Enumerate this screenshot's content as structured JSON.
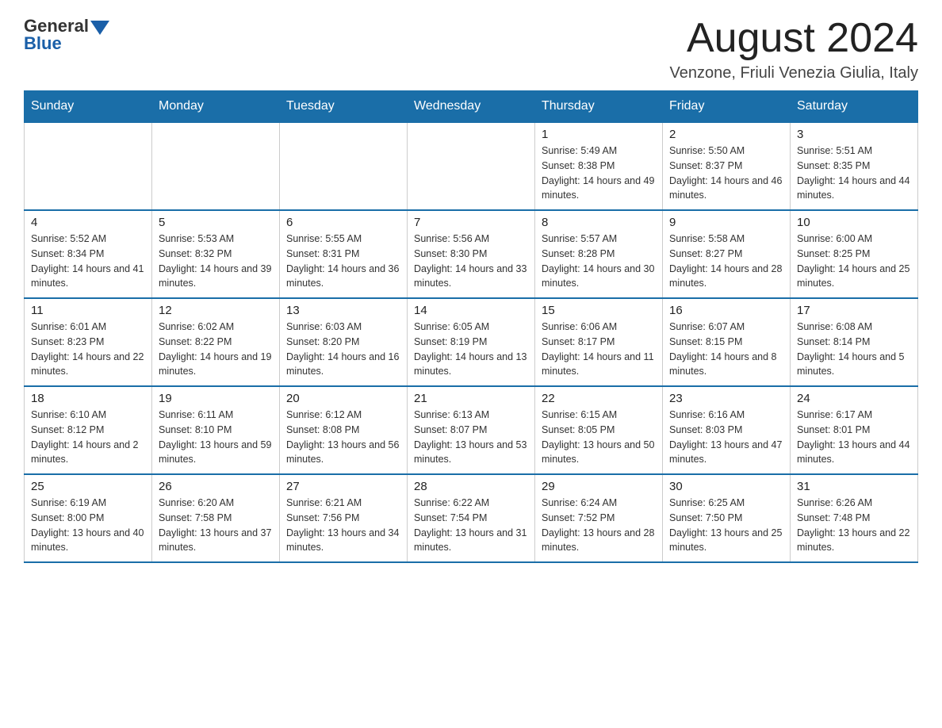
{
  "logo": {
    "text_general": "General",
    "text_blue": "Blue"
  },
  "header": {
    "month_title": "August 2024",
    "location": "Venzone, Friuli Venezia Giulia, Italy"
  },
  "weekdays": [
    "Sunday",
    "Monday",
    "Tuesday",
    "Wednesday",
    "Thursday",
    "Friday",
    "Saturday"
  ],
  "weeks": [
    [
      {
        "day": "",
        "info": ""
      },
      {
        "day": "",
        "info": ""
      },
      {
        "day": "",
        "info": ""
      },
      {
        "day": "",
        "info": ""
      },
      {
        "day": "1",
        "info": "Sunrise: 5:49 AM\nSunset: 8:38 PM\nDaylight: 14 hours and 49 minutes."
      },
      {
        "day": "2",
        "info": "Sunrise: 5:50 AM\nSunset: 8:37 PM\nDaylight: 14 hours and 46 minutes."
      },
      {
        "day": "3",
        "info": "Sunrise: 5:51 AM\nSunset: 8:35 PM\nDaylight: 14 hours and 44 minutes."
      }
    ],
    [
      {
        "day": "4",
        "info": "Sunrise: 5:52 AM\nSunset: 8:34 PM\nDaylight: 14 hours and 41 minutes."
      },
      {
        "day": "5",
        "info": "Sunrise: 5:53 AM\nSunset: 8:32 PM\nDaylight: 14 hours and 39 minutes."
      },
      {
        "day": "6",
        "info": "Sunrise: 5:55 AM\nSunset: 8:31 PM\nDaylight: 14 hours and 36 minutes."
      },
      {
        "day": "7",
        "info": "Sunrise: 5:56 AM\nSunset: 8:30 PM\nDaylight: 14 hours and 33 minutes."
      },
      {
        "day": "8",
        "info": "Sunrise: 5:57 AM\nSunset: 8:28 PM\nDaylight: 14 hours and 30 minutes."
      },
      {
        "day": "9",
        "info": "Sunrise: 5:58 AM\nSunset: 8:27 PM\nDaylight: 14 hours and 28 minutes."
      },
      {
        "day": "10",
        "info": "Sunrise: 6:00 AM\nSunset: 8:25 PM\nDaylight: 14 hours and 25 minutes."
      }
    ],
    [
      {
        "day": "11",
        "info": "Sunrise: 6:01 AM\nSunset: 8:23 PM\nDaylight: 14 hours and 22 minutes."
      },
      {
        "day": "12",
        "info": "Sunrise: 6:02 AM\nSunset: 8:22 PM\nDaylight: 14 hours and 19 minutes."
      },
      {
        "day": "13",
        "info": "Sunrise: 6:03 AM\nSunset: 8:20 PM\nDaylight: 14 hours and 16 minutes."
      },
      {
        "day": "14",
        "info": "Sunrise: 6:05 AM\nSunset: 8:19 PM\nDaylight: 14 hours and 13 minutes."
      },
      {
        "day": "15",
        "info": "Sunrise: 6:06 AM\nSunset: 8:17 PM\nDaylight: 14 hours and 11 minutes."
      },
      {
        "day": "16",
        "info": "Sunrise: 6:07 AM\nSunset: 8:15 PM\nDaylight: 14 hours and 8 minutes."
      },
      {
        "day": "17",
        "info": "Sunrise: 6:08 AM\nSunset: 8:14 PM\nDaylight: 14 hours and 5 minutes."
      }
    ],
    [
      {
        "day": "18",
        "info": "Sunrise: 6:10 AM\nSunset: 8:12 PM\nDaylight: 14 hours and 2 minutes."
      },
      {
        "day": "19",
        "info": "Sunrise: 6:11 AM\nSunset: 8:10 PM\nDaylight: 13 hours and 59 minutes."
      },
      {
        "day": "20",
        "info": "Sunrise: 6:12 AM\nSunset: 8:08 PM\nDaylight: 13 hours and 56 minutes."
      },
      {
        "day": "21",
        "info": "Sunrise: 6:13 AM\nSunset: 8:07 PM\nDaylight: 13 hours and 53 minutes."
      },
      {
        "day": "22",
        "info": "Sunrise: 6:15 AM\nSunset: 8:05 PM\nDaylight: 13 hours and 50 minutes."
      },
      {
        "day": "23",
        "info": "Sunrise: 6:16 AM\nSunset: 8:03 PM\nDaylight: 13 hours and 47 minutes."
      },
      {
        "day": "24",
        "info": "Sunrise: 6:17 AM\nSunset: 8:01 PM\nDaylight: 13 hours and 44 minutes."
      }
    ],
    [
      {
        "day": "25",
        "info": "Sunrise: 6:19 AM\nSunset: 8:00 PM\nDaylight: 13 hours and 40 minutes."
      },
      {
        "day": "26",
        "info": "Sunrise: 6:20 AM\nSunset: 7:58 PM\nDaylight: 13 hours and 37 minutes."
      },
      {
        "day": "27",
        "info": "Sunrise: 6:21 AM\nSunset: 7:56 PM\nDaylight: 13 hours and 34 minutes."
      },
      {
        "day": "28",
        "info": "Sunrise: 6:22 AM\nSunset: 7:54 PM\nDaylight: 13 hours and 31 minutes."
      },
      {
        "day": "29",
        "info": "Sunrise: 6:24 AM\nSunset: 7:52 PM\nDaylight: 13 hours and 28 minutes."
      },
      {
        "day": "30",
        "info": "Sunrise: 6:25 AM\nSunset: 7:50 PM\nDaylight: 13 hours and 25 minutes."
      },
      {
        "day": "31",
        "info": "Sunrise: 6:26 AM\nSunset: 7:48 PM\nDaylight: 13 hours and 22 minutes."
      }
    ]
  ]
}
